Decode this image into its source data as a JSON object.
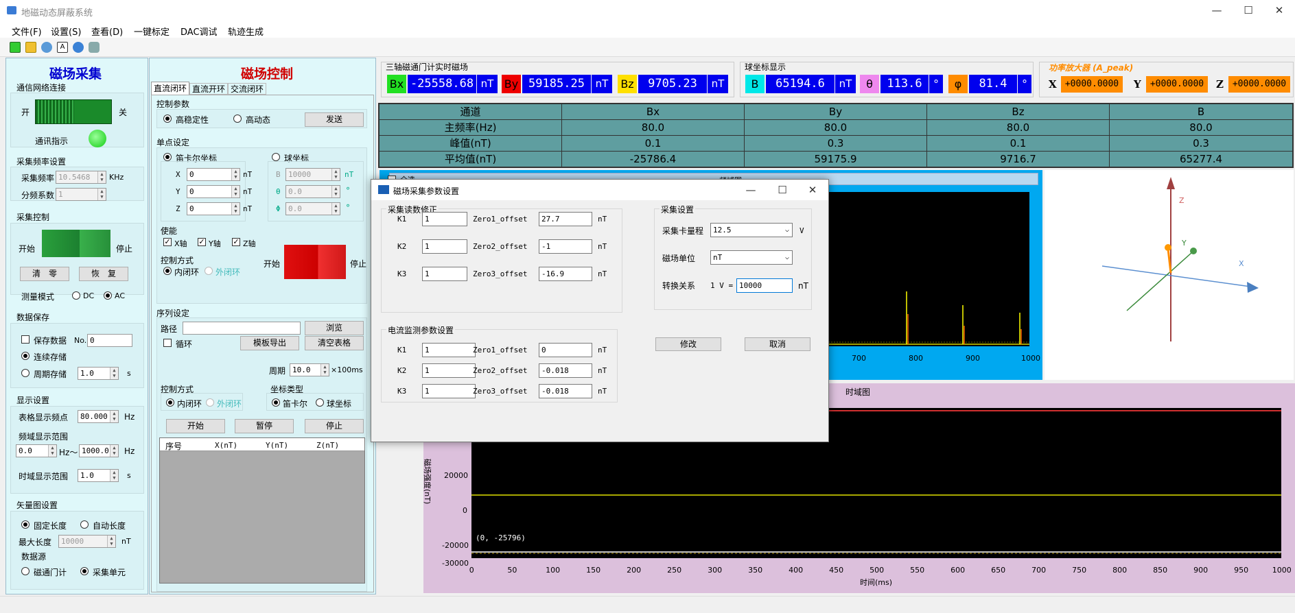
{
  "window": {
    "title": "地磁动态屏蔽系统",
    "min": "—",
    "max": "☐",
    "close": "✕"
  },
  "menu": [
    "文件(F)",
    "设置(S)",
    "查看(D)",
    "一键标定",
    "DAC调试",
    "轨迹生成"
  ],
  "toolbar_icons": [
    "new-icon",
    "open-icon",
    "people-icon",
    "pdf-icon",
    "gear-icon",
    "database-icon"
  ],
  "left": {
    "title": "磁场采集",
    "net": {
      "title": "通信网络连接",
      "on": "开",
      "off": "关",
      "indicator": "通讯指示"
    },
    "freq": {
      "title": "采集频率设置",
      "rate_label": "采集频率",
      "rate": "10.5468",
      "rate_unit": "KHz",
      "div_label": "分频系数",
      "div": "1"
    },
    "ctrl": {
      "title": "采集控制",
      "start": "开始",
      "stop": "停止",
      "zero": "清　零",
      "restore": "恢　复",
      "mode_label": "测量模式",
      "dc": "DC",
      "ac": "AC"
    },
    "save": {
      "title": "数据保存",
      "save_data": "保存数据",
      "no_label": "No.",
      "no": "0",
      "continuous": "连续存储",
      "periodic": "周期存储",
      "period": "1.0",
      "unit": "s"
    },
    "display": {
      "title": "显示设置",
      "table_freq_label": "表格显示频点",
      "table_freq": "80.000",
      "hz": "Hz",
      "freq_range_label": "频域显示范围",
      "f_from": "0.0",
      "f_to": "1000.0",
      "hz_tilde": "Hz～",
      "time_range_label": "时域显示范围",
      "t_range": "1.0",
      "s": "s"
    },
    "vector": {
      "title": "矢量图设置",
      "fixed": "固定长度",
      "auto": "自动长度",
      "max_label": "最大长度",
      "max": "10000",
      "nt": "nT",
      "source": "数据源",
      "fluxgate": "磁通门计",
      "unit": "采集单元"
    }
  },
  "mid": {
    "title": "磁场控制",
    "tabs": [
      "直流闭环",
      "直流开环",
      "交流闭环"
    ],
    "params": {
      "title": "控制参数",
      "high_stab": "高稳定性",
      "high_dyn": "高动态",
      "send": "发送"
    },
    "point": {
      "title": "单点设定",
      "cart": "笛卡尔坐标",
      "sph": "球坐标",
      "x": "0",
      "y": "0",
      "z": "0",
      "b": "10000",
      "theta": "0.0",
      "phi": "0.0",
      "nt": "nT",
      "deg": "°",
      "X": "X",
      "Y": "Y",
      "Z": "Z",
      "B": "B",
      "TH": "θ",
      "PH": "Φ"
    },
    "enable": {
      "title": "使能",
      "x": "X轴",
      "y": "Y轴",
      "z": "Z轴",
      "start": "开始",
      "stop": "停止"
    },
    "method": {
      "title": "控制方式",
      "inner": "内闭环",
      "outer": "外闭环"
    },
    "seq": {
      "title": "序列设定",
      "path": "路径",
      "browse": "浏览",
      "loop": "循环",
      "export": "模板导出",
      "clear": "清空表格",
      "period_label": "周期",
      "period": "10.0",
      "period_unit": "×100ms",
      "method": "控制方式",
      "inner": "内闭环",
      "outer": "外闭环",
      "coord": "坐标类型",
      "cart": "笛卡尔",
      "sph": "球坐标",
      "start": "开始",
      "pause": "暂停",
      "stop": "停止",
      "cols": [
        "序号",
        "X(nT)",
        "Y(nT)",
        "Z(nT)"
      ]
    }
  },
  "realtime": {
    "title": "三轴磁通门计实时磁场",
    "bx_label": "Bx",
    "bx": "-25558.68",
    "by_label": "By",
    "by": "59185.25",
    "bz_label": "Bz",
    "bz": "9705.23",
    "unit": "nT"
  },
  "sphere": {
    "title": "球坐标显示",
    "b_label": "B",
    "b": "65194.6",
    "b_unit": "nT",
    "theta_label": "θ",
    "theta": "113.6",
    "phi_label": "φ",
    "phi": "81.4",
    "deg": "°"
  },
  "amp": {
    "title": "功率放大器 (A_peak)",
    "x_label": "X",
    "x": "+0000.0000",
    "y_label": "Y",
    "y": "+0000.0000",
    "z_label": "Z",
    "z": "+0000.0000"
  },
  "stats": {
    "headers": [
      "通道",
      "Bx",
      "By",
      "Bz",
      "B"
    ],
    "rows": [
      [
        "主频率(Hz)",
        "80.0",
        "80.0",
        "80.0",
        "80.0"
      ],
      [
        "峰值(nT)",
        "0.1",
        "0.3",
        "0.1",
        "0.3"
      ],
      [
        "平均值(nT)",
        "-25786.4",
        "59175.9",
        "9716.7",
        "65277.4"
      ]
    ]
  },
  "freq_chart": {
    "title": "频域图",
    "x_ticks": [
      "700",
      "800",
      "900",
      "1000"
    ],
    "partial_label": "全选"
  },
  "time_chart": {
    "title": "时域图",
    "y_label": "磁场强度(nT)",
    "x_label": "时间(ms)",
    "y_ticks": [
      "20000",
      "0",
      "-20000",
      "-30000"
    ],
    "x_ticks": [
      "0",
      "50",
      "100",
      "150",
      "200",
      "250",
      "300",
      "350",
      "400",
      "450",
      "500",
      "550",
      "600",
      "650",
      "700",
      "750",
      "800",
      "850",
      "900",
      "950",
      "1000"
    ],
    "cursor": "(0, -25796)"
  },
  "vector3d": {
    "x": "X",
    "y": "Y",
    "z": "Z"
  },
  "dialog": {
    "title": "磁场采集参数设置",
    "min": "—",
    "max": "☐",
    "close": "✕",
    "read": {
      "title": "采集读数修正",
      "rows": [
        {
          "k": "K1",
          "kv": "1",
          "z": "Zero1_offset",
          "zv": "27.7"
        },
        {
          "k": "K2",
          "kv": "1",
          "z": "Zero2_offset",
          "zv": "-1"
        },
        {
          "k": "K3",
          "kv": "1",
          "z": "Zero3_offset",
          "zv": "-16.9"
        }
      ],
      "unit": "nT"
    },
    "current": {
      "title": "电流监测参数设置",
      "rows": [
        {
          "k": "K1",
          "kv": "1",
          "z": "Zero1_offset",
          "zv": "0"
        },
        {
          "k": "K2",
          "kv": "1",
          "z": "Zero2_offset",
          "zv": "-0.018"
        },
        {
          "k": "K3",
          "kv": "1",
          "z": "Zero3_offset",
          "zv": "-0.018"
        }
      ],
      "unit": "nT"
    },
    "acq": {
      "title": "采集设置",
      "range_label": "采集卡量程",
      "range": "12.5",
      "v": "V",
      "unit_label": "磁场单位",
      "unit": "nT",
      "conv_label": "转换关系",
      "conv_prefix": "1 V =",
      "conv": "10000",
      "conv_unit": "nT"
    },
    "modify": "修改",
    "cancel": "取消"
  }
}
